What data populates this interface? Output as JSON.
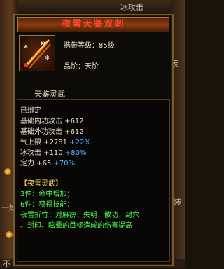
{
  "background": {
    "top_right_label": "冰攻击",
    "bottom_left_label": "不",
    "right_label_1": "装",
    "right_label_2": "装",
    "left_label": "一炼"
  },
  "tooltip": {
    "title": "夜雪天鉴双刺",
    "icon": "twin-dagger-icon",
    "level_req": "携带等级：85级",
    "grade": "品阶：天阶",
    "weapon_name": "天鉴灵武",
    "bound": "已绑定",
    "stats": [
      {
        "label": "基础内功攻击",
        "value": "+612"
      },
      {
        "label": "基础外功攻击",
        "value": "+612"
      },
      {
        "label": "气上限",
        "value": "+2781",
        "bonus": "+22%"
      },
      {
        "label": "冰攻击",
        "value": "+110",
        "bonus": "+80%"
      },
      {
        "label": "定力",
        "value": "+65",
        "bonus": "+70%"
      }
    ],
    "set_name": "【夜雪灵武】",
    "set_bonus_3": "3件：命中增加；",
    "set_bonus_6": "6件：获得技能：",
    "set_desc_1": "夜雪折竹：对麻痹、失明、散功、封穴",
    "set_desc_2": "、封印、眩晕的目标造成的伤害提高"
  },
  "colors": {
    "title": "#ff4a2a",
    "blue_bonus": "#4ab4ff",
    "green_set": "#4aff4a",
    "yellow_set_name": "#ffe060"
  }
}
